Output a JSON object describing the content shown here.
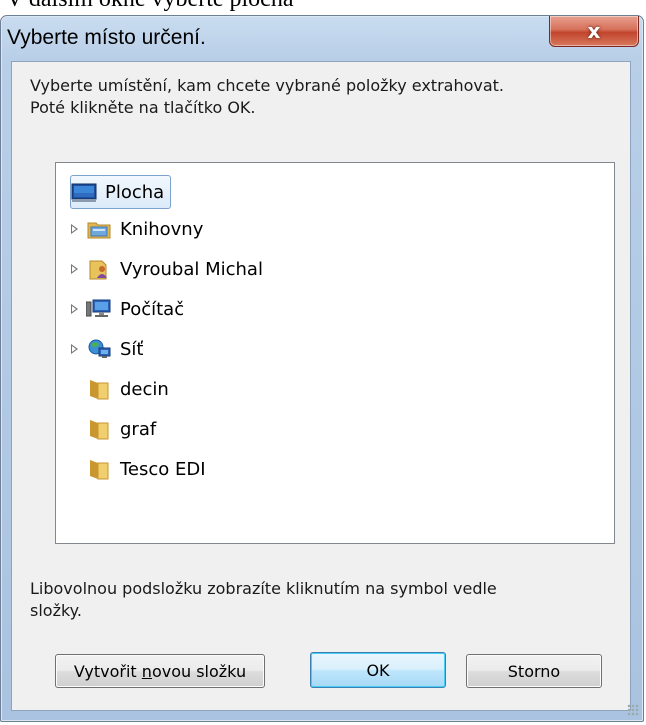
{
  "caption": "V dalším okně vyberte plocha",
  "window": {
    "title": "Vyberte místo určení.",
    "close_symbol": "x"
  },
  "instructions": {
    "line1": "Vyberte umístění, kam chcete vybrané položky extrahovat.",
    "line2": "Poté klikněte na tlačítko OK."
  },
  "tree": {
    "items": [
      {
        "label": "Plocha",
        "icon": "desktop-icon",
        "expandable": false,
        "selected": true
      },
      {
        "label": "Knihovny",
        "icon": "libraries-icon",
        "expandable": true
      },
      {
        "label": "Vyroubal Michal",
        "icon": "user-folder-icon",
        "expandable": true
      },
      {
        "label": "Počítač",
        "icon": "computer-icon",
        "expandable": true
      },
      {
        "label": "Síť",
        "icon": "network-icon",
        "expandable": true
      },
      {
        "label": "decin",
        "icon": "folder-icon",
        "expandable": false
      },
      {
        "label": "graf",
        "icon": "folder-icon",
        "expandable": false
      },
      {
        "label": "Tesco EDI",
        "icon": "folder-icon",
        "expandable": false
      }
    ]
  },
  "hint": {
    "line1": "Libovolnou podsložku zobrazíte kliknutím na symbol vedle",
    "line2": "složky."
  },
  "buttons": {
    "new_folder_pre": "Vytvořit ",
    "new_folder_accel": "n",
    "new_folder_post": "ovou složku",
    "ok": "OK",
    "cancel": "Storno"
  },
  "colors": {
    "selection_border": "#7da2ce",
    "folder": "#e8c25b",
    "close_button": "#c2452d"
  }
}
